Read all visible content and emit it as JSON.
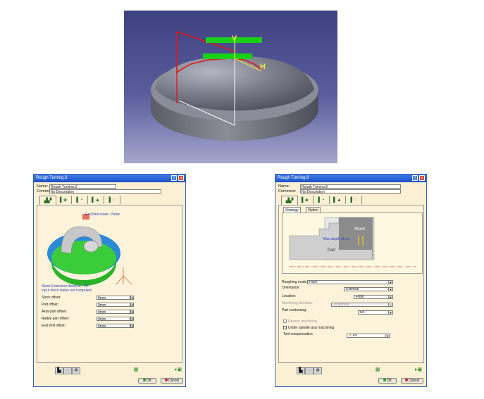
{
  "viewport": {
    "axis_v_label": "V",
    "axis_h_label": "H",
    "colors": {
      "bg_top": "#3e4080",
      "part": "#7a7c88",
      "profile": "#e01818",
      "plane": "#18d018",
      "axis": "#e8e840"
    }
  },
  "dialog_left": {
    "title": "Rough Turning.3",
    "name_label": "Name:",
    "name_value": "Rough Turning.3",
    "comment_label": "Comment:",
    "comment_value": "No Description",
    "tabs": [
      "strategy-icon",
      "tool-icon",
      "feeds-icon",
      "macro-icon",
      "geometry-icon"
    ],
    "end_limit_text": "End limit mode : None",
    "status_line1": "Stock Extension distance : Off",
    "status_line2": "Input stock status not computed",
    "offsets": [
      {
        "label": "Stock offset:",
        "value": "0mm"
      },
      {
        "label": "Part offset:",
        "value": "0mm"
      },
      {
        "label": "Axial part offset:",
        "value": "0mm"
      },
      {
        "label": "Radial part offset:",
        "value": "0mm"
      },
      {
        "label": "End limit offset:",
        "value": "0mm"
      }
    ],
    "ok_label": "OK",
    "cancel_label": "Cancel"
  },
  "dialog_right": {
    "title": "Rough Turning.8",
    "name_label": "Name:",
    "name_value": "Rough Turning.8",
    "comment_label": "Comment:",
    "comment_value": "No Description",
    "subtabs": [
      "Strategy",
      "Option"
    ],
    "diagram": {
      "stock": "Stock",
      "part": "Part",
      "max_depth": "Max depth of cut"
    },
    "fields": [
      {
        "label": "Roughing mode:",
        "value": "Face",
        "disabled": false
      },
      {
        "label": "Orientation:",
        "value": "External",
        "disabled": false
      },
      {
        "label": "Location:",
        "value": "Front",
        "disabled": false
      },
      {
        "label": "Machining direction:",
        "value": "To spindle",
        "disabled": true
      },
      {
        "label": "Part contouring:",
        "value": "No",
        "disabled": false
      }
    ],
    "recess_label": "Recess machining",
    "spindle_label": "Under spindle axis machining",
    "tool_comp_label": "Tool compensation",
    "tool_comp_value": "P9",
    "ok_label": "OK",
    "cancel_label": "Cancel"
  }
}
